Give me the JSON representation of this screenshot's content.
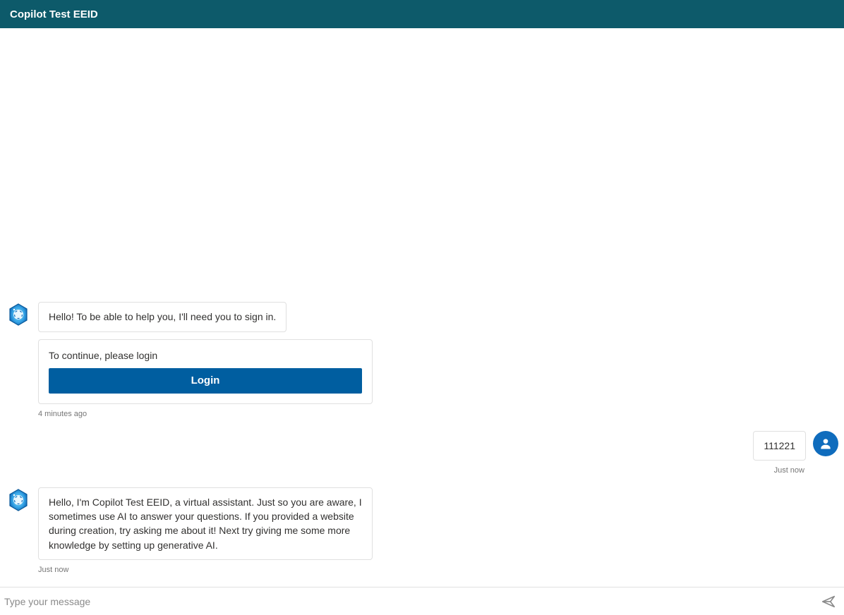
{
  "header": {
    "title": "Copilot Test EEID"
  },
  "messages": {
    "bot1": {
      "text": "Hello! To be able to help you, I'll need you to sign in.",
      "login_prompt": "To continue, please login",
      "login_button": "Login",
      "timestamp": "4 minutes ago"
    },
    "user1": {
      "text": "111221",
      "timestamp": "Just now"
    },
    "bot2": {
      "text": "Hello, I'm Copilot Test EEID, a virtual assistant. Just so you are aware, I sometimes use AI to answer your questions. If you provided a website during creation, try asking me about it! Next try giving me some more knowledge by setting up generative AI.",
      "timestamp": "Just now"
    }
  },
  "input": {
    "placeholder": "Type your message"
  },
  "colors": {
    "header_bg": "#0d5a6a",
    "primary_button": "#005ea0",
    "user_avatar": "#0f6cbd"
  }
}
